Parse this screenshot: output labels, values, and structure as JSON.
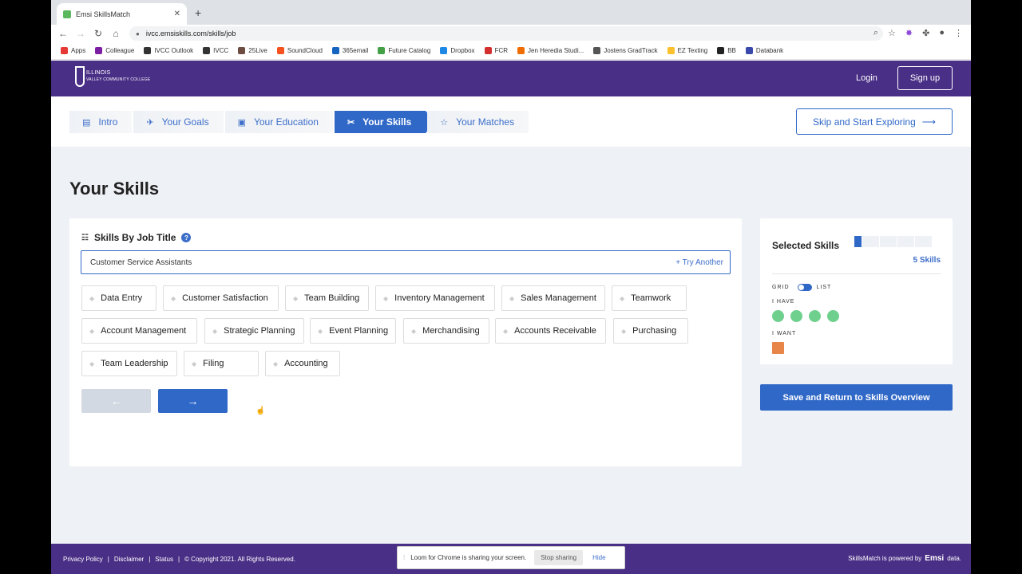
{
  "browser": {
    "tab_title": "Emsi SkillsMatch",
    "url": "ivcc.emsiskills.com/skills/job",
    "bookmarks": [
      "Apps",
      "Colleague",
      "IVCC Outlook",
      "IVCC",
      "25Live",
      "SoundCloud",
      "365email",
      "Future Catalog",
      "Dropbox",
      "FCR",
      "Jen Heredia Studi...",
      "Jostens GradTrack",
      "EZ Texting",
      "BB",
      "Databank"
    ]
  },
  "header": {
    "logo_line1": "ILLINOIS",
    "logo_line2": "VALLEY COMMUNITY COLLEGE",
    "login": "Login",
    "signup": "Sign up"
  },
  "steps": [
    {
      "label": "Intro",
      "icon": "book-icon",
      "glyph": "▤"
    },
    {
      "label": "Your Goals",
      "icon": "rocket-icon",
      "glyph": "✈"
    },
    {
      "label": "Your Education",
      "icon": "id-card-icon",
      "glyph": "▣"
    },
    {
      "label": "Your Skills",
      "icon": "tools-icon",
      "glyph": "✂",
      "active": true
    },
    {
      "label": "Your Matches",
      "icon": "star-icon",
      "glyph": "☆"
    }
  ],
  "skip_button": "Skip and Start Exploring",
  "page_title": "Your Skills",
  "skills_card": {
    "title": "Skills By Job Title",
    "job_value": "Customer Service Assistants",
    "try_another": "+ Try Another",
    "skills": [
      "Data Entry",
      "Customer Satisfaction",
      "Team Building",
      "Inventory Management",
      "Sales Management",
      "Teamwork",
      "Account Management",
      "Strategic Planning",
      "Event Planning",
      "Merchandising",
      "Accounts Receivable",
      "Purchasing",
      "Team Leadership",
      "Filing",
      "Accounting"
    ],
    "prev_label": "←",
    "next_label": "→"
  },
  "selected": {
    "title": "Selected Skills",
    "count_label": "5 Skills",
    "grid_label": "GRID",
    "list_label": "LIST",
    "have_label": "I HAVE",
    "want_label": "I WANT",
    "have_count": 4,
    "want_count": 1,
    "have_color": "#6fd08e",
    "want_color": "#e8864a"
  },
  "save_button": "Save and Return to Skills Overview",
  "footer": {
    "links": [
      "Privacy Policy",
      "|",
      "Disclaimer",
      "|",
      "Status",
      "|",
      "© Copyright 2021. All Rights Reserved."
    ],
    "powered_text": "SkillsMatch is powered by",
    "brand": "Emsi",
    "brand_suffix": "data."
  },
  "share_bar": {
    "message": "Loom for Chrome is sharing your screen.",
    "stop": "Stop sharing",
    "hide": "Hide"
  },
  "colors": {
    "accent": "#3068c8",
    "brand": "#4a2f86"
  }
}
